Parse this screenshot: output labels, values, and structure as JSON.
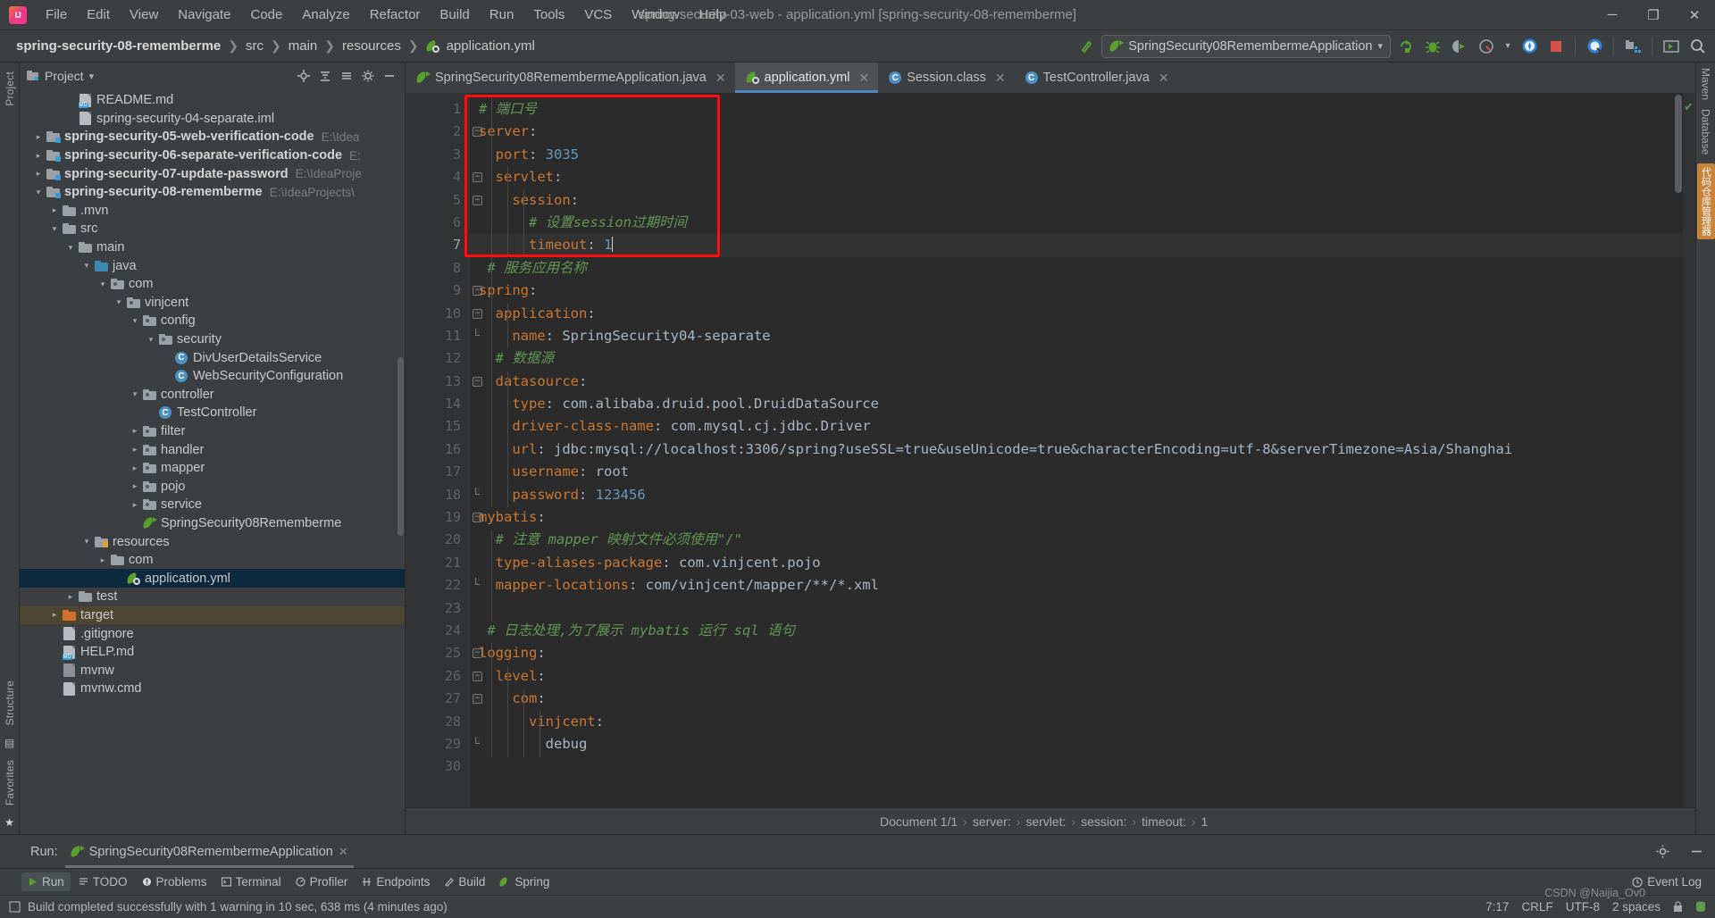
{
  "window": {
    "title": "spring-security-03-web - application.yml [spring-security-08-rememberme]",
    "minimize": "─",
    "maximize": "❐",
    "close": "✕"
  },
  "menu": {
    "items": [
      "File",
      "Edit",
      "View",
      "Navigate",
      "Code",
      "Analyze",
      "Refactor",
      "Build",
      "Run",
      "Tools",
      "VCS",
      "Window",
      "Help"
    ]
  },
  "navbar": {
    "breadcrumbs": [
      "spring-security-08-rememberme",
      "src",
      "main",
      "resources",
      "application.yml"
    ],
    "run_config": "SpringSecurity08RemembermeApplication",
    "dropdown_caret": "▾",
    "icons": [
      "build-hammer-icon",
      "rerun-icon",
      "debug-icon",
      "run-with-coverage-icon",
      "profile-icon",
      "profile-dropdown-icon",
      "update-icon",
      "stop-icon",
      "search-everywhere-icon",
      "project-structure-icon",
      "settings-icon",
      "search-icon"
    ]
  },
  "rail_left": {
    "top": [
      "Project"
    ],
    "bottom": [
      "Structure",
      "Favorites"
    ]
  },
  "rail_right": {
    "items": [
      "Maven",
      "Database",
      "代码仓库管理器"
    ]
  },
  "project_panel": {
    "title": "Project",
    "caret": "▾",
    "actions": [
      "locate-icon",
      "collapse-all-icon",
      "expand-icon",
      "settings-icon",
      "hide-icon"
    ],
    "tree": [
      {
        "depth": 2,
        "arrow": "",
        "icon": "md-file",
        "label": "README.md",
        "bold": false,
        "path": ""
      },
      {
        "depth": 2,
        "arrow": "",
        "icon": "iml-file",
        "label": "spring-security-04-separate.iml",
        "bold": false,
        "path": ""
      },
      {
        "depth": 0,
        "arrow": "›",
        "icon": "module",
        "label": "spring-security-05-web-verification-code",
        "bold": true,
        "path": "E:\\Idea"
      },
      {
        "depth": 0,
        "arrow": "›",
        "icon": "module",
        "label": "spring-security-06-separate-verification-code",
        "bold": true,
        "path": "E:"
      },
      {
        "depth": 0,
        "arrow": "›",
        "icon": "module",
        "label": "spring-security-07-update-password",
        "bold": true,
        "path": "E:\\IdeaProje"
      },
      {
        "depth": 0,
        "arrow": "∨",
        "icon": "module",
        "label": "spring-security-08-rememberme",
        "bold": true,
        "path": "E:\\IdeaProjects\\"
      },
      {
        "depth": 1,
        "arrow": "›",
        "icon": "folder",
        "label": ".mvn",
        "bold": false,
        "path": ""
      },
      {
        "depth": 1,
        "arrow": "∨",
        "icon": "folder",
        "label": "src",
        "bold": false,
        "path": ""
      },
      {
        "depth": 2,
        "arrow": "∨",
        "icon": "folder",
        "label": "main",
        "bold": false,
        "path": ""
      },
      {
        "depth": 3,
        "arrow": "∨",
        "icon": "src-folder",
        "label": "java",
        "bold": false,
        "path": ""
      },
      {
        "depth": 4,
        "arrow": "∨",
        "icon": "package",
        "label": "com",
        "bold": false,
        "path": ""
      },
      {
        "depth": 5,
        "arrow": "∨",
        "icon": "package",
        "label": "vinjcent",
        "bold": false,
        "path": ""
      },
      {
        "depth": 6,
        "arrow": "∨",
        "icon": "package",
        "label": "config",
        "bold": false,
        "path": ""
      },
      {
        "depth": 7,
        "arrow": "∨",
        "icon": "package",
        "label": "security",
        "bold": false,
        "path": ""
      },
      {
        "depth": 8,
        "arrow": "",
        "icon": "class",
        "label": "DivUserDetailsService",
        "bold": false,
        "path": ""
      },
      {
        "depth": 8,
        "arrow": "",
        "icon": "class",
        "label": "WebSecurityConfiguration",
        "bold": false,
        "path": ""
      },
      {
        "depth": 6,
        "arrow": "∨",
        "icon": "package",
        "label": "controller",
        "bold": false,
        "path": ""
      },
      {
        "depth": 7,
        "arrow": "",
        "icon": "class",
        "label": "TestController",
        "bold": false,
        "path": ""
      },
      {
        "depth": 6,
        "arrow": "›",
        "icon": "package",
        "label": "filter",
        "bold": false,
        "path": ""
      },
      {
        "depth": 6,
        "arrow": "›",
        "icon": "package",
        "label": "handler",
        "bold": false,
        "path": ""
      },
      {
        "depth": 6,
        "arrow": "›",
        "icon": "package",
        "label": "mapper",
        "bold": false,
        "path": ""
      },
      {
        "depth": 6,
        "arrow": "›",
        "icon": "package",
        "label": "pojo",
        "bold": false,
        "path": ""
      },
      {
        "depth": 6,
        "arrow": "›",
        "icon": "package",
        "label": "service",
        "bold": false,
        "path": ""
      },
      {
        "depth": 6,
        "arrow": "",
        "icon": "spring-class",
        "label": "SpringSecurity08Rememberme",
        "bold": false,
        "path": ""
      },
      {
        "depth": 3,
        "arrow": "∨",
        "icon": "resources-folder",
        "label": "resources",
        "bold": false,
        "path": ""
      },
      {
        "depth": 4,
        "arrow": "›",
        "icon": "folder",
        "label": "com",
        "bold": false,
        "path": ""
      },
      {
        "depth": 5,
        "arrow": "",
        "icon": "yml",
        "label": "application.yml",
        "bold": false,
        "path": "",
        "selected": true
      },
      {
        "depth": 2,
        "arrow": "›",
        "icon": "folder",
        "label": "test",
        "bold": false,
        "path": ""
      },
      {
        "depth": 1,
        "arrow": "›",
        "icon": "target-folder",
        "label": "target",
        "bold": false,
        "path": "",
        "highlight": true
      },
      {
        "depth": 1,
        "arrow": "",
        "icon": "gitignore-file",
        "label": ".gitignore",
        "bold": false,
        "path": ""
      },
      {
        "depth": 1,
        "arrow": "",
        "icon": "md-file",
        "label": "HELP.md",
        "bold": false,
        "path": ""
      },
      {
        "depth": 1,
        "arrow": "",
        "icon": "sh-file",
        "label": "mvnw",
        "bold": false,
        "path": ""
      },
      {
        "depth": 1,
        "arrow": "",
        "icon": "cmd-file",
        "label": "mvnw.cmd",
        "bold": false,
        "path": ""
      }
    ]
  },
  "editor_tabs": [
    {
      "label": "SpringSecurity08RemembermeApplication.java",
      "icon": "spring-class-icon",
      "active": false,
      "close": "✕"
    },
    {
      "label": "application.yml",
      "icon": "yml-icon",
      "active": true,
      "close": "✕"
    },
    {
      "label": "Session.class",
      "icon": "class-icon",
      "active": false,
      "close": "✕"
    },
    {
      "label": "TestController.java",
      "icon": "class-icon",
      "active": false,
      "close": "✕"
    }
  ],
  "editor": {
    "current_line": 7,
    "caret_char": "|",
    "highlight_box_color": "#fd0d0d",
    "gutter_check": "✔",
    "lines": [
      {
        "n": 1,
        "fold": "",
        "segments": [
          {
            "t": "# 端口号",
            "c": "cm"
          }
        ]
      },
      {
        "n": 2,
        "fold": "minus",
        "segments": [
          {
            "t": "server",
            "c": "k"
          },
          {
            "t": ":",
            "c": "s"
          }
        ]
      },
      {
        "n": 3,
        "fold": "",
        "segments": [
          {
            "t": "  port",
            "c": "k"
          },
          {
            "t": ": ",
            "c": "s"
          },
          {
            "t": "3035",
            "c": "n"
          }
        ]
      },
      {
        "n": 4,
        "fold": "minus",
        "segments": [
          {
            "t": "  servlet",
            "c": "k"
          },
          {
            "t": ":",
            "c": "s"
          }
        ]
      },
      {
        "n": 5,
        "fold": "minus",
        "segments": [
          {
            "t": "    session",
            "c": "k"
          },
          {
            "t": ":",
            "c": "s"
          }
        ]
      },
      {
        "n": 6,
        "fold": "",
        "segments": [
          {
            "t": "      # 设置session过期时间",
            "c": "cm"
          }
        ]
      },
      {
        "n": 7,
        "fold": "end",
        "segments": [
          {
            "t": "      timeout",
            "c": "k"
          },
          {
            "t": ": ",
            "c": "s"
          },
          {
            "t": "1",
            "c": "n"
          }
        ]
      },
      {
        "n": 8,
        "fold": "",
        "segments": [
          {
            "t": " # 服务应用名称",
            "c": "cm"
          }
        ]
      },
      {
        "n": 9,
        "fold": "minus",
        "segments": [
          {
            "t": "spring",
            "c": "k"
          },
          {
            "t": ":",
            "c": "s"
          }
        ]
      },
      {
        "n": 10,
        "fold": "minus",
        "segments": [
          {
            "t": "  application",
            "c": "k"
          },
          {
            "t": ":",
            "c": "s"
          }
        ]
      },
      {
        "n": 11,
        "fold": "end",
        "segments": [
          {
            "t": "    name",
            "c": "k"
          },
          {
            "t": ": ",
            "c": "s"
          },
          {
            "t": "SpringSecurity04-separate",
            "c": "s"
          }
        ]
      },
      {
        "n": 12,
        "fold": "",
        "segments": [
          {
            "t": "  # 数据源",
            "c": "cm"
          }
        ]
      },
      {
        "n": 13,
        "fold": "minus",
        "segments": [
          {
            "t": "  datasource",
            "c": "k"
          },
          {
            "t": ":",
            "c": "s"
          }
        ]
      },
      {
        "n": 14,
        "fold": "",
        "segments": [
          {
            "t": "    type",
            "c": "k"
          },
          {
            "t": ": ",
            "c": "s"
          },
          {
            "t": "com.alibaba.druid.pool.DruidDataSource",
            "c": "s"
          }
        ]
      },
      {
        "n": 15,
        "fold": "",
        "segments": [
          {
            "t": "    driver-class-name",
            "c": "k"
          },
          {
            "t": ": ",
            "c": "s"
          },
          {
            "t": "com.mysql.cj.jdbc.Driver",
            "c": "s"
          }
        ]
      },
      {
        "n": 16,
        "fold": "",
        "segments": [
          {
            "t": "    url",
            "c": "k"
          },
          {
            "t": ": ",
            "c": "s"
          },
          {
            "t": "jdbc:mysql://localhost:3306/spring?useSSL=true&useUnicode=true&characterEncoding=utf-8&serverTimezone=Asia/Shanghai",
            "c": "s"
          }
        ]
      },
      {
        "n": 17,
        "fold": "",
        "segments": [
          {
            "t": "    username",
            "c": "k"
          },
          {
            "t": ": ",
            "c": "s"
          },
          {
            "t": "root",
            "c": "s"
          }
        ]
      },
      {
        "n": 18,
        "fold": "end",
        "segments": [
          {
            "t": "    password",
            "c": "k"
          },
          {
            "t": ": ",
            "c": "s"
          },
          {
            "t": "123456",
            "c": "n"
          }
        ]
      },
      {
        "n": 19,
        "fold": "minus",
        "segments": [
          {
            "t": "mybatis",
            "c": "k"
          },
          {
            "t": ":",
            "c": "s"
          }
        ]
      },
      {
        "n": 20,
        "fold": "",
        "segments": [
          {
            "t": "  # 注意 mapper 映射文件必须使用\"/\"",
            "c": "cm"
          }
        ]
      },
      {
        "n": 21,
        "fold": "",
        "segments": [
          {
            "t": "  type-aliases-package",
            "c": "k"
          },
          {
            "t": ": ",
            "c": "s"
          },
          {
            "t": "com.vinjcent.pojo",
            "c": "s"
          }
        ]
      },
      {
        "n": 22,
        "fold": "end",
        "segments": [
          {
            "t": "  mapper-locations",
            "c": "k"
          },
          {
            "t": ": ",
            "c": "s"
          },
          {
            "t": "com/vinjcent/mapper/**/*.xml",
            "c": "s"
          }
        ]
      },
      {
        "n": 23,
        "fold": "",
        "segments": [
          {
            "t": "",
            "c": "s"
          }
        ]
      },
      {
        "n": 24,
        "fold": "",
        "segments": [
          {
            "t": " # 日志处理,为了展示 mybatis 运行 sql 语句",
            "c": "cm"
          }
        ]
      },
      {
        "n": 25,
        "fold": "minus",
        "segments": [
          {
            "t": "logging",
            "c": "k"
          },
          {
            "t": ":",
            "c": "s"
          }
        ]
      },
      {
        "n": 26,
        "fold": "minus",
        "segments": [
          {
            "t": "  level",
            "c": "k"
          },
          {
            "t": ":",
            "c": "s"
          }
        ]
      },
      {
        "n": 27,
        "fold": "minus",
        "segments": [
          {
            "t": "    com",
            "c": "k"
          },
          {
            "t": ":",
            "c": "s"
          }
        ]
      },
      {
        "n": 28,
        "fold": "",
        "segments": [
          {
            "t": "      vinjcent",
            "c": "k"
          },
          {
            "t": ":",
            "c": "s"
          }
        ]
      },
      {
        "n": 29,
        "fold": "end",
        "segments": [
          {
            "t": "        debug",
            "c": "s"
          }
        ]
      },
      {
        "n": 30,
        "fold": "",
        "segments": [
          {
            "t": "",
            "c": "s"
          }
        ]
      }
    ]
  },
  "doc_breadcrumb": {
    "items": [
      "Document 1/1",
      "server:",
      "servlet:",
      "session:",
      "timeout:",
      "1"
    ],
    "sep": "›"
  },
  "run_window": {
    "label": "Run:",
    "tab": "SpringSecurity08RemembermeApplication",
    "close": "✕",
    "settings_icon": "gear-icon",
    "hide_icon": "minimize-icon"
  },
  "tool_strip": {
    "items": [
      {
        "label": "Run",
        "icon": "run-icon",
        "active": true
      },
      {
        "label": "TODO",
        "icon": "todo-icon",
        "active": false
      },
      {
        "label": "Problems",
        "icon": "problems-icon",
        "active": false
      },
      {
        "label": "Terminal",
        "icon": "terminal-icon",
        "active": false
      },
      {
        "label": "Profiler",
        "icon": "profiler-icon",
        "active": false
      },
      {
        "label": "Endpoints",
        "icon": "endpoints-icon",
        "active": false
      },
      {
        "label": "Build",
        "icon": "build-icon",
        "active": false
      },
      {
        "label": "Spring",
        "icon": "spring-icon",
        "active": false
      }
    ],
    "event_log": "Event Log",
    "event_log_icon": "event-log-icon"
  },
  "status_bar": {
    "message": "Build completed successfully with 1 warning in 10 sec, 638 ms (4 minutes ago)",
    "message_icon": "build-status-icon",
    "caret_position": "7:17",
    "line_separator": "CRLF",
    "encoding": "UTF-8",
    "indent": "2 spaces",
    "lock_icon": "lock-icon",
    "db_icon": "database-icon",
    "watermark": "CSDN @Naijia_Ov0"
  }
}
